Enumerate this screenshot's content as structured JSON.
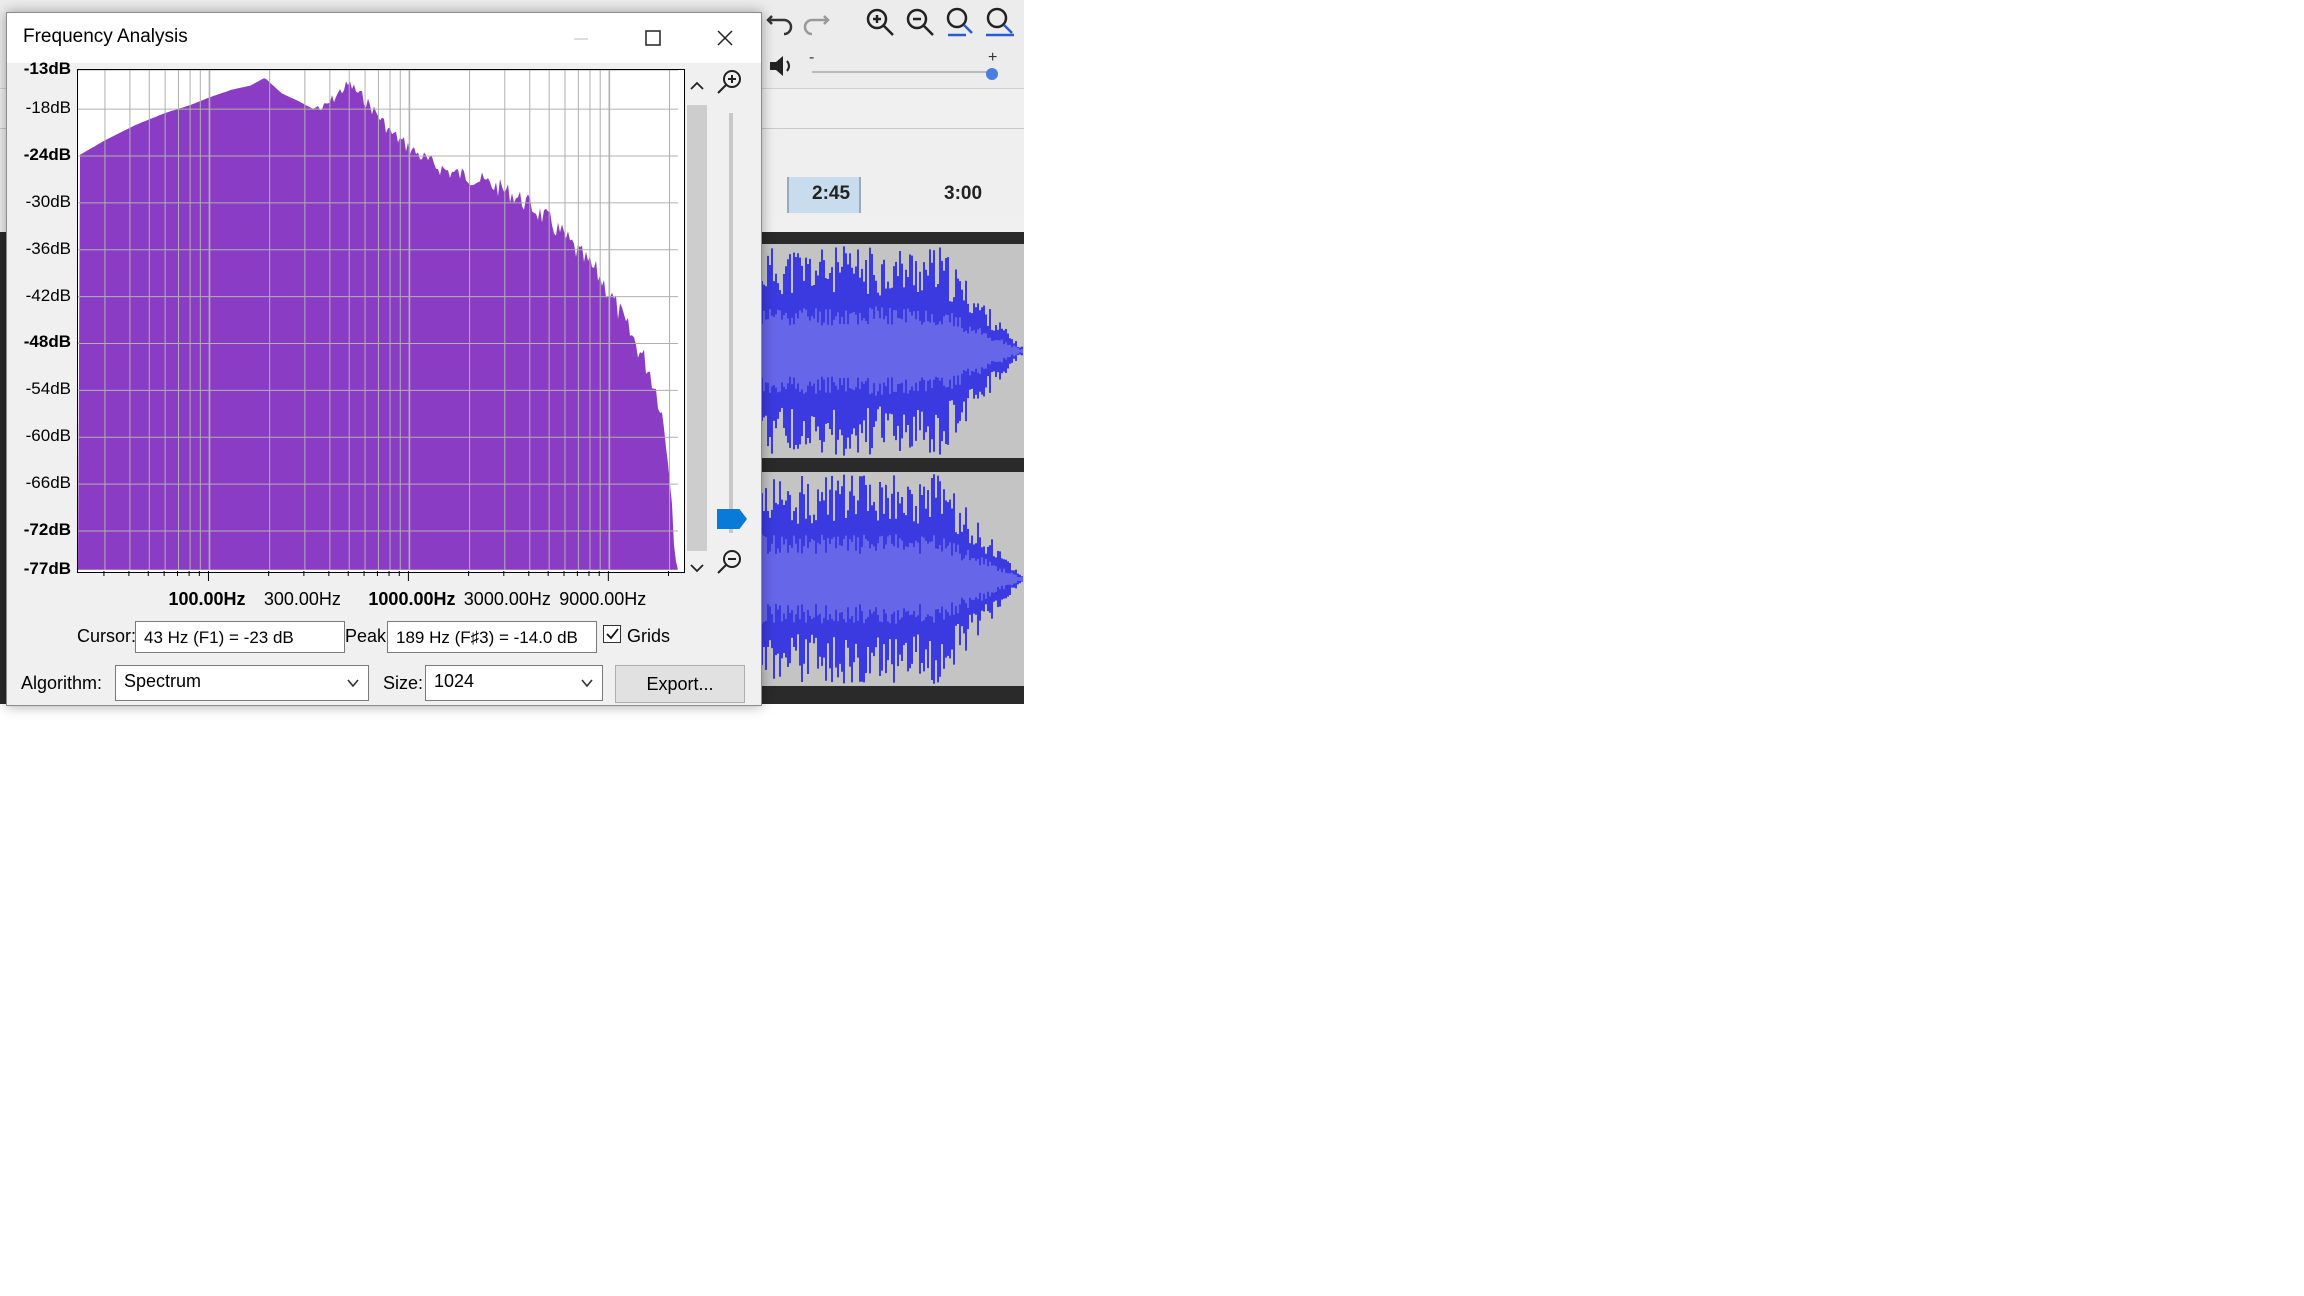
{
  "dialog": {
    "title": "Frequency Analysis",
    "minimize_icon": "minimize-icon",
    "maximize_icon": "maximize-icon",
    "close_icon": "close-icon",
    "cursor_label": "Cursor:",
    "cursor_value": "43 Hz (F1) = -23 dB",
    "peak_label": "Peak:",
    "peak_value": "189 Hz (F♯3) = -14.0 dB",
    "grids_label": "Grids",
    "grids_checked": true,
    "algorithm_label": "Algorithm:",
    "algorithm_value": "Spectrum",
    "size_label": "Size:",
    "size_value": "1024",
    "export_label": "Export...",
    "plot_color": "#8b3cc4"
  },
  "chart_data": {
    "type": "area",
    "title": "",
    "xlabel": "",
    "ylabel": "",
    "x_scale": "log",
    "xlim": [
      22,
      22050
    ],
    "ylim": [
      -77,
      -13
    ],
    "y_tick_labels": [
      "-13dB",
      "-18dB",
      "-24dB",
      "-30dB",
      "-36dB",
      "-42dB",
      "-48dB",
      "-54dB",
      "-60dB",
      "-66dB",
      "-72dB",
      "-77dB"
    ],
    "y_tick_values": [
      -13,
      -18,
      -24,
      -30,
      -36,
      -42,
      -48,
      -54,
      -60,
      -66,
      -72,
      -77
    ],
    "x_tick_labels": [
      "100.00Hz",
      "300.00Hz",
      "1000.00Hz",
      "3000.00Hz",
      "9000.00Hz"
    ],
    "x_tick_values": [
      100,
      300,
      1000,
      3000,
      9000
    ],
    "grid": true,
    "series": [
      {
        "x": [
          22,
          30,
          43,
          60,
          80,
          100,
          130,
          160,
          189,
          230,
          280,
          330,
          380,
          450,
          500,
          600,
          700,
          800,
          1000,
          1300,
          1600,
          2000,
          2600,
          3200,
          4000,
          5000,
          6000,
          7000,
          8000,
          9000,
          10000,
          11000,
          12000,
          14000,
          16000,
          18000,
          20000,
          21000,
          22050
        ],
        "values": [
          -24,
          -22,
          -20,
          -18.5,
          -17.5,
          -16.5,
          -15.5,
          -15,
          -14,
          -16,
          -17,
          -18,
          -17,
          -15,
          -14,
          -16,
          -18,
          -20,
          -22,
          -24,
          -25,
          -25.5,
          -26.5,
          -27.5,
          -29,
          -31,
          -33,
          -35,
          -36.5,
          -38,
          -40,
          -42,
          -44,
          -47,
          -50,
          -54,
          -62,
          -70,
          -77
        ]
      }
    ]
  },
  "background_app": {
    "timeline_labels": [
      "2:45",
      "3:00"
    ],
    "waveform_color": "#3a3ae0",
    "waveform_inner_color": "#6666e8"
  }
}
